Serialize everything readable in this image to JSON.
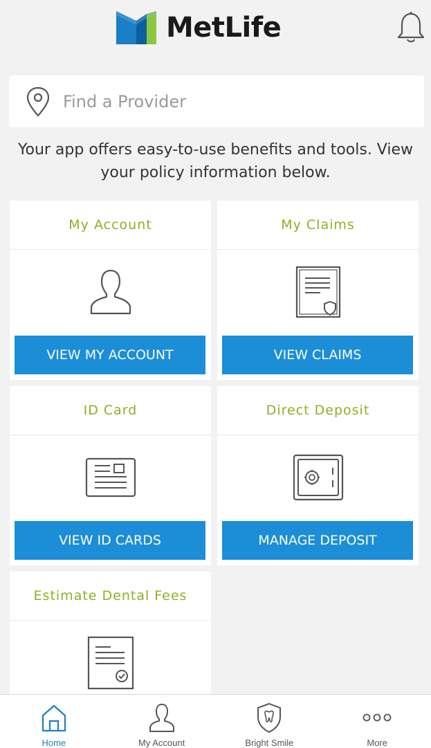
{
  "header": {
    "brand_name": "MetLife",
    "brand_colors": [
      "#1a7fc4",
      "#0c5f9e",
      "#8cc63f"
    ],
    "notifications_icon": "bell-icon"
  },
  "search": {
    "placeholder": "Find a Provider",
    "icon": "location-pin-icon"
  },
  "intro_text": "Your app offers easy-to-use benefits and tools. View your policy information below.",
  "cards": [
    {
      "title": "My Account",
      "icon": "user-icon",
      "button_label": "VIEW MY ACCOUNT"
    },
    {
      "title": "My Claims",
      "icon": "claim-document-icon",
      "button_label": "VIEW CLAIMS"
    },
    {
      "title": "ID Card",
      "icon": "id-card-icon",
      "button_label": "VIEW ID CARDS"
    },
    {
      "title": "Direct Deposit",
      "icon": "safe-icon",
      "button_label": "MANAGE DEPOSIT"
    },
    {
      "title": "Estimate Dental Fees",
      "icon": "estimate-document-icon"
    }
  ],
  "tabbar": {
    "items": [
      {
        "label": "Home",
        "icon": "home-icon",
        "active": true
      },
      {
        "label": "My Account",
        "icon": "user-icon",
        "active": false
      },
      {
        "label": "Bright Smile",
        "icon": "tooth-shield-icon",
        "active": false
      },
      {
        "label": "More",
        "icon": "more-dots-icon",
        "active": false
      }
    ]
  },
  "colors": {
    "accent_blue": "#1c8ed8",
    "title_green": "#8cb023",
    "active_tab": "#1c7fc4"
  }
}
